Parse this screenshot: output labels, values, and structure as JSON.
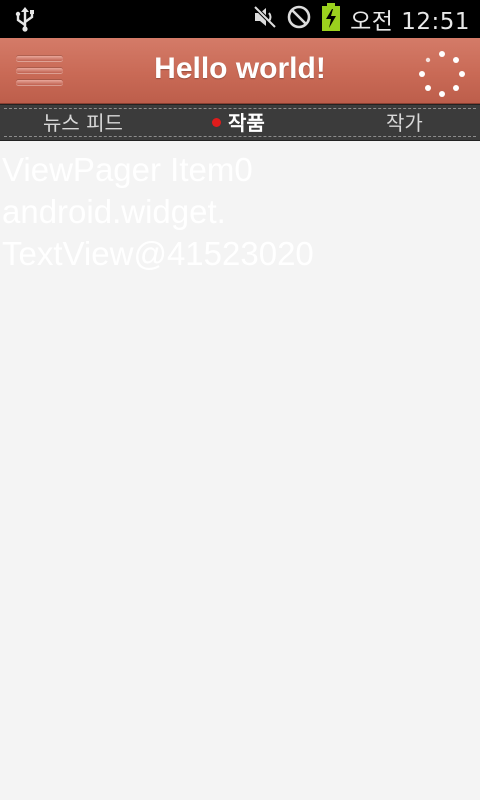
{
  "status_bar": {
    "icons": [
      "usb-icon",
      "muted-icon",
      "blocked-icon",
      "battery-charging-icon"
    ],
    "clock": "오전 12:51"
  },
  "action_bar": {
    "menu_icon": "menu-icon",
    "title": "Hello world!",
    "spinner_icon": "loading-spinner-icon"
  },
  "tabs": [
    {
      "label": "뉴스 피드",
      "active": false
    },
    {
      "label": "작품",
      "active": true
    },
    {
      "label": "작가",
      "active": false
    }
  ],
  "pager": {
    "text_line1": "ViewPager Item0",
    "text_line2": "android.widget.",
    "text_line3": "TextView@41523020"
  },
  "colors": {
    "action_bar": "#c96a56",
    "tab_strip": "#3b3b3b",
    "active_dot": "#e01c1c",
    "content_bg": "#f4f4f4"
  }
}
